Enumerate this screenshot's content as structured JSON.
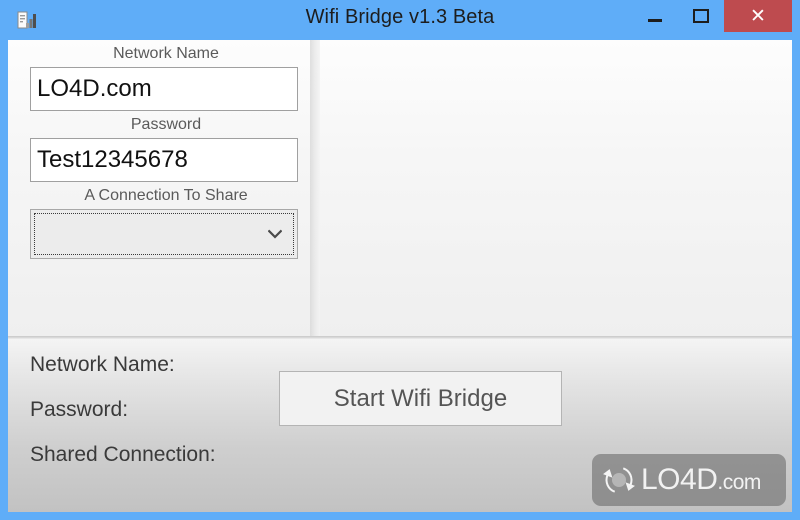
{
  "window": {
    "title": "Wifi Bridge v1.3 Beta",
    "icon": "signal-bars-icon",
    "accent_color": "#5FADF8",
    "close_color": "#BE4B4F",
    "controls": {
      "minimize_label": "–",
      "maximize_label": "□",
      "close_label": "✕"
    }
  },
  "form": {
    "network_name": {
      "label": "Network Name",
      "value": "LO4D.com",
      "placeholder": ""
    },
    "password": {
      "label": "Password",
      "value": "Test12345678",
      "placeholder": ""
    },
    "connection_to_share": {
      "label": "A Connection To Share",
      "value": "",
      "placeholder": "",
      "options": []
    }
  },
  "actions": {
    "start_label": "Start Wifi Bridge"
  },
  "status": {
    "lines": [
      "Network Name:",
      "Password:",
      "Shared Connection:"
    ]
  },
  "watermark": {
    "name": "LO4D",
    "tld": ".com",
    "logo": "circular-arrows-icon"
  }
}
